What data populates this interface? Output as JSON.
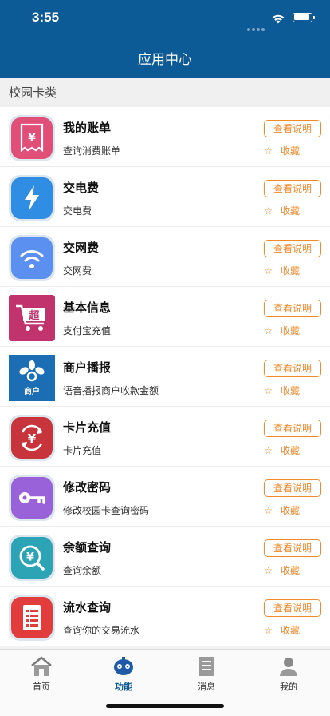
{
  "status_bar": {
    "time": "3:55"
  },
  "nav": {
    "title": "应用中心"
  },
  "section": {
    "label": "校园卡类"
  },
  "apps": [
    {
      "icon": "receipt-yen-icon",
      "title": "我的账单",
      "desc": "查询消费账单",
      "help": "查看说明",
      "fav": "收藏",
      "star": "☆"
    },
    {
      "icon": "lightning-bolt-icon",
      "title": "交电费",
      "desc": "交电费",
      "help": "查看说明",
      "fav": "收藏",
      "star": "☆"
    },
    {
      "icon": "wifi-icon",
      "title": "交网费",
      "desc": "交网费",
      "help": "查看说明",
      "fav": "收藏",
      "star": "☆"
    },
    {
      "icon": "shopping-cart-icon",
      "title": "基本信息",
      "desc": "支付宝充值",
      "help": "查看说明",
      "fav": "收藏",
      "star": "☆",
      "icon_text": "超"
    },
    {
      "icon": "merchant-logo-icon",
      "title": "商户播报",
      "desc": "语音播报商户收款金额",
      "help": "查看说明",
      "fav": "收藏",
      "star": "☆",
      "icon_text": "商户"
    },
    {
      "icon": "recharge-yen-icon",
      "title": "卡片充值",
      "desc": "卡片充值",
      "help": "查看说明",
      "fav": "收藏",
      "star": "☆"
    },
    {
      "icon": "key-icon",
      "title": "修改密码",
      "desc": "修改校园卡查询密码",
      "help": "查看说明",
      "fav": "收藏",
      "star": "☆"
    },
    {
      "icon": "balance-yen-icon",
      "title": "余额查询",
      "desc": "查询余额",
      "help": "查看说明",
      "fav": "收藏",
      "star": "☆"
    },
    {
      "icon": "document-list-icon",
      "title": "流水查询",
      "desc": "查询你的交易流水",
      "help": "查看说明",
      "fav": "收藏",
      "star": "☆"
    }
  ],
  "tabs": [
    {
      "icon": "home-icon",
      "label": "首页"
    },
    {
      "icon": "robot-icon",
      "label": "功能",
      "active": true
    },
    {
      "icon": "document-icon",
      "label": "消息"
    },
    {
      "icon": "user-icon",
      "label": "我的"
    }
  ],
  "colors": {
    "header": "#0c5a96",
    "accent": "#f08a2b"
  }
}
